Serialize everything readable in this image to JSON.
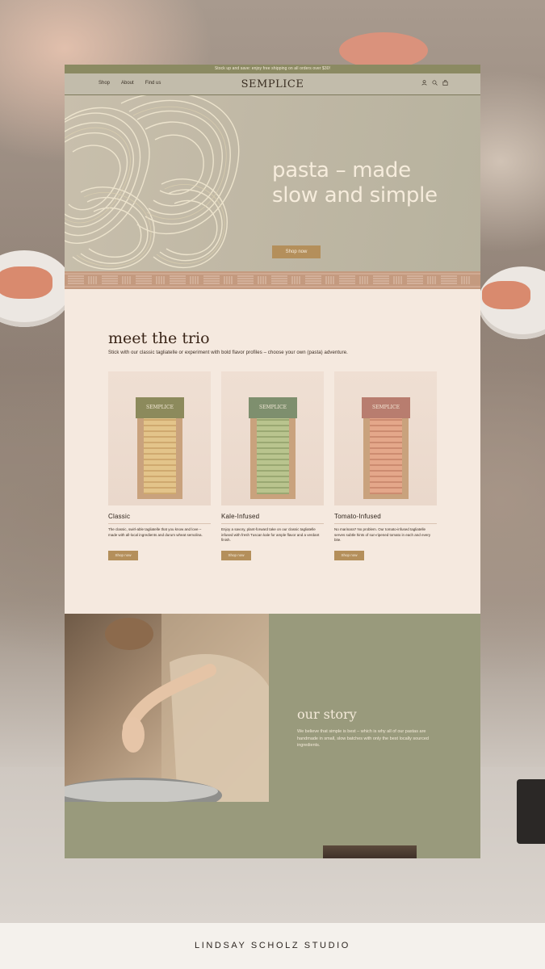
{
  "announcement": "Stock up and save: enjoy free shipping on all orders over $30!",
  "header": {
    "nav": [
      "Shop",
      "About",
      "Find us"
    ],
    "logo": "SEMPLICE",
    "icons": [
      "user-icon",
      "search-icon",
      "bag-icon"
    ]
  },
  "hero": {
    "title": "pasta – made\nslow and simple",
    "cta": "Shop now"
  },
  "trio": {
    "title": "meet the trio",
    "subtitle": "Stick with our classic tagliatelle or experiment with bold flavor profiles – choose your own (pasta) adventure.",
    "products": [
      {
        "name": "Classic",
        "description": "The classic, swirl-able tagliatelle that you know and love – made with all-local ingredients and durum wheat semolina.",
        "cta": "Shop now",
        "bag_label": "SEMPLICE",
        "label_color": "#8c8a5c",
        "pasta_color": "#e3c48a"
      },
      {
        "name": "Kale-Infused",
        "description": "Enjoy a savory, plant-forward take on our classic tagliatelle infused with fresh Tuscan kale for ample flavor and a verdant finish.",
        "cta": "Shop now",
        "bag_label": "SEMPLICE",
        "label_color": "#7e8f6e",
        "pasta_color": "#b9c48e"
      },
      {
        "name": "Tomato-Infused",
        "description": "No marinara? No problem. Our tomato-infused tagliatelle serves subtle hints of sun-ripened tomato in each and every bite.",
        "cta": "Shop now",
        "bag_label": "SEMPLICE",
        "label_color": "#b87d6f",
        "pasta_color": "#e4a78a"
      }
    ]
  },
  "story": {
    "title": "our story",
    "text": "We believe that simple is best – which is why all of our pastas are handmade in small, slow batches with only the best locally sourced ingredients."
  },
  "footer": {
    "credit": "LINDSAY SCHOLZ STUDIO"
  },
  "colors": {
    "accent": "#b48f5b",
    "olive": "#8b8a62",
    "story_bg": "#999a7c",
    "cream": "#f5e9df"
  }
}
